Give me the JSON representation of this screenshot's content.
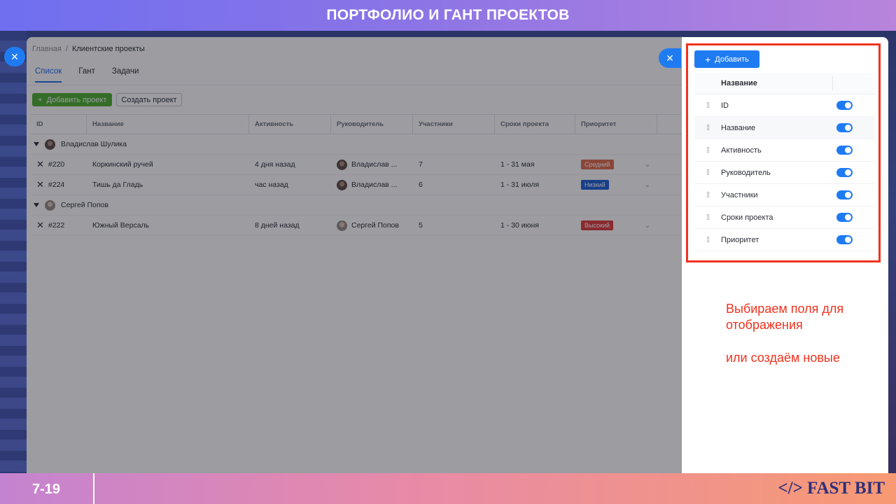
{
  "slide": {
    "title": "ПОРТФОЛИО И ГАНТ ПРОЕКТОВ",
    "page_number": "7-19",
    "brand": "</> FAST BIT"
  },
  "app": {
    "breadcrumb": {
      "home": "Главная",
      "separator": "/",
      "current": "Клиентские проекты"
    },
    "tabs": [
      {
        "label": "Список",
        "active": true
      },
      {
        "label": "Гант",
        "active": false
      },
      {
        "label": "Задачи",
        "active": false
      }
    ],
    "actions": {
      "add_project": "Добавить проект",
      "create_project": "Создать проект"
    },
    "table": {
      "columns": [
        "ID",
        "Название",
        "Активность",
        "Руководитель",
        "Участники",
        "Сроки проекта",
        "Приоритет"
      ],
      "groups": [
        {
          "owner": "Владислав Шулика",
          "rows": [
            {
              "id": "#220",
              "name": "Коркинский ручей",
              "activity": "4 дня назад",
              "manager": "Владислав ...",
              "participants": "7",
              "dates": "1 - 31 мая",
              "priority": "Средний",
              "priority_color": "#e06b4a"
            },
            {
              "id": "#224",
              "name": "Тишь да Гладь",
              "activity": "час назад",
              "manager": "Владислав ...",
              "participants": "6",
              "dates": "1 - 31 июля",
              "priority": "Низкий",
              "priority_color": "#1f5fd6"
            }
          ]
        },
        {
          "owner": "Сергей Попов",
          "rows": [
            {
              "id": "#222",
              "name": "Южный Версаль",
              "activity": "8 дней назад",
              "manager": "Сергей Попов",
              "participants": "5",
              "dates": "1 - 30 июня",
              "priority": "Высокий",
              "priority_color": "#e03b3b"
            }
          ]
        }
      ]
    }
  },
  "panel": {
    "add_label": "Добавить",
    "header": "Название",
    "fields": [
      {
        "label": "ID",
        "enabled": true
      },
      {
        "label": "Название",
        "enabled": true
      },
      {
        "label": "Активность",
        "enabled": true
      },
      {
        "label": "Руководитель",
        "enabled": true
      },
      {
        "label": "Участники",
        "enabled": true
      },
      {
        "label": "Сроки проекта",
        "enabled": true
      },
      {
        "label": "Приоритет",
        "enabled": true
      }
    ]
  },
  "annotation": {
    "line1": "Выбираем поля для отображения",
    "line2": "или создаём новые"
  },
  "colors": {
    "accent": "#1f7bf2",
    "highlight": "#f0321e",
    "green": "#4caf2e"
  }
}
